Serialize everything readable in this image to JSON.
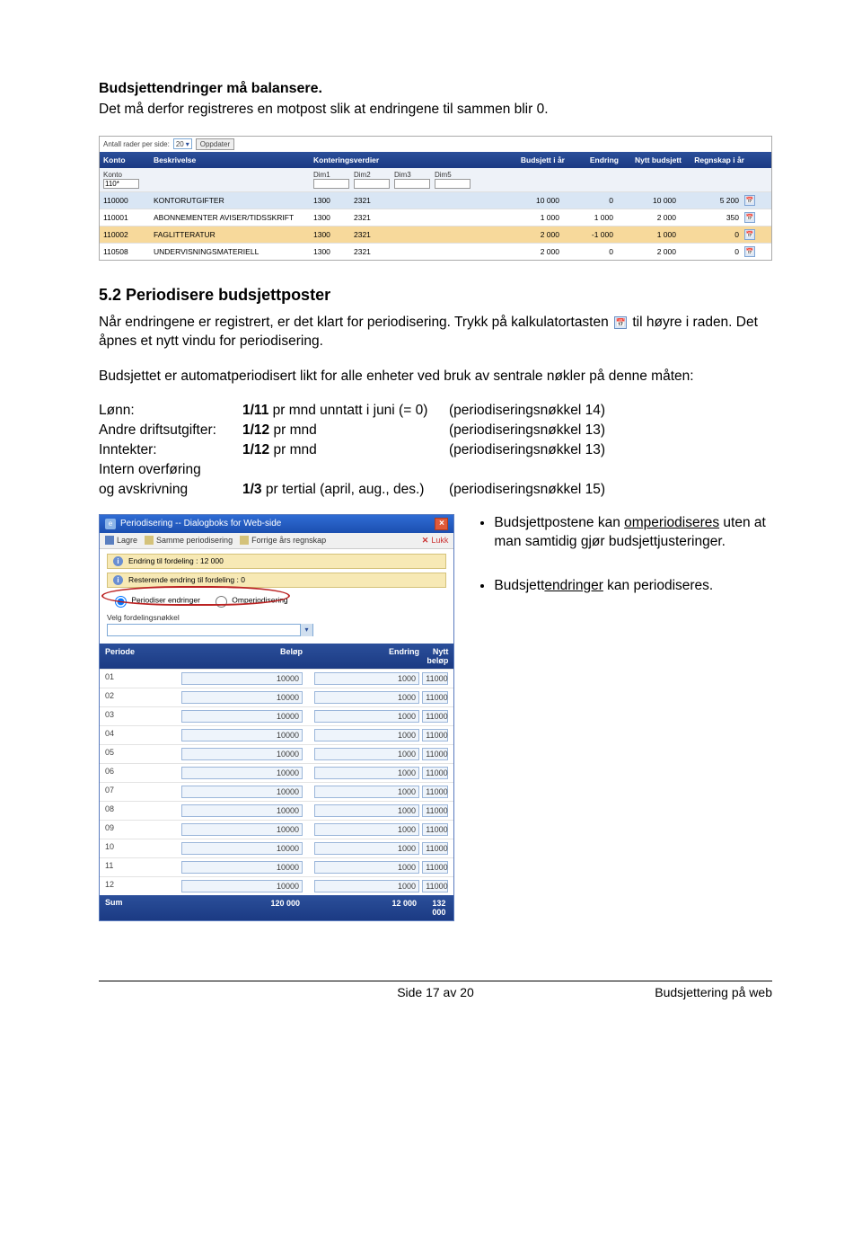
{
  "header": {
    "title": "Budsjettendringer må balansere.",
    "subtitle": "Det må derfor registreres en motpost slik at endringene til sammen blir 0."
  },
  "shot1": {
    "rows_per_side_label": "Antall rader per side:",
    "rows_per_side_value": "20",
    "oppdater_btn": "Oppdater",
    "columns": {
      "konto": "Konto",
      "beskrivelse": "Beskrivelse",
      "konteringsverdier": "Konteringsverdier",
      "budsjett": "Budsjett i år",
      "endring": "Endring",
      "nytt": "Nytt budsjett",
      "regnskap": "Regnskap i år"
    },
    "subcolumns": {
      "konto_label": "Konto",
      "konto_value": "110*",
      "dim1": "Dim1",
      "dim2": "Dim2",
      "dim3": "Dim3",
      "dim5": "Dim5"
    },
    "rows": [
      {
        "konto": "110000",
        "besk": "KONTORUTGIFTER",
        "d1": "1300",
        "d2": "2321",
        "bud": "10 000",
        "end": "0",
        "nytt": "10 000",
        "reg": "5 200"
      },
      {
        "konto": "110001",
        "besk": "ABONNEMENTER AVISER/TIDSSKRIFT",
        "d1": "1300",
        "d2": "2321",
        "bud": "1 000",
        "end": "1 000",
        "nytt": "2 000",
        "reg": "350"
      },
      {
        "konto": "110002",
        "besk": "FAGLITTERATUR",
        "d1": "1300",
        "d2": "2321",
        "bud": "2 000",
        "end": "-1 000",
        "nytt": "1 000",
        "reg": "0"
      },
      {
        "konto": "110508",
        "besk": "UNDERVISNINGSMATERIELL",
        "d1": "1300",
        "d2": "2321",
        "bud": "2 000",
        "end": "0",
        "nytt": "2 000",
        "reg": "0"
      }
    ]
  },
  "section": {
    "num_title": "5.2  Periodisere budsjettposter",
    "p1a": "Når endringene er registrert, er det klart for periodisering. Trykk på kalkulatortasten",
    "p1b": "til høyre i raden. Det åpnes et nytt vindu for periodisering.",
    "p2": "Budsjettet er automatperiodisert likt for alle enheter ved bruk av sentrale nøkler på denne måten:"
  },
  "keys": {
    "lonn_label": "Lønn:",
    "lonn_rate": "1/11",
    "lonn_rate_suffix": " pr mnd unntatt i juni (= 0)",
    "lonn_note": "(periodiseringsnøkkel 14)",
    "drift_label": "Andre driftsutgifter:",
    "drift_rate": "1/12",
    "drift_rate_suffix": " pr mnd",
    "drift_note": "(periodiseringsnøkkel 13)",
    "innt_label": "Inntekter:",
    "innt_rate": "1/12",
    "innt_rate_suffix": " pr mnd",
    "innt_note": "(periodiseringsnøkkel 13)",
    "intern_label1": "Intern overføring",
    "intern_label2": "og avskrivning",
    "intern_rate": "1/3",
    "intern_rate_suffix": " pr tertial (april, aug., des.)",
    "intern_note": "(periodiseringsnøkkel 15)"
  },
  "shot2": {
    "title": "Periodisering -- Dialogboks for Web-side",
    "toolbar": {
      "lagre": "Lagre",
      "samme": "Samme periodisering",
      "forrige": "Forrige års regnskap",
      "lukk": "Lukk"
    },
    "info1": "Endring til fordeling : 12 000",
    "info2": "Resterende endring til fordeling : 0",
    "radio1": "Periodiser endringer",
    "radio2": "Omperiodisering",
    "select_label": "Velg fordelingsnøkkel",
    "cols": {
      "periode": "Periode",
      "belop": "Beløp",
      "endring": "Endring",
      "nytt": "Nytt beløp"
    },
    "rows": [
      {
        "p": "01",
        "b": "10000",
        "e": "1000",
        "n": "11000"
      },
      {
        "p": "02",
        "b": "10000",
        "e": "1000",
        "n": "11000"
      },
      {
        "p": "03",
        "b": "10000",
        "e": "1000",
        "n": "11000"
      },
      {
        "p": "04",
        "b": "10000",
        "e": "1000",
        "n": "11000"
      },
      {
        "p": "05",
        "b": "10000",
        "e": "1000",
        "n": "11000"
      },
      {
        "p": "06",
        "b": "10000",
        "e": "1000",
        "n": "11000"
      },
      {
        "p": "07",
        "b": "10000",
        "e": "1000",
        "n": "11000"
      },
      {
        "p": "08",
        "b": "10000",
        "e": "1000",
        "n": "11000"
      },
      {
        "p": "09",
        "b": "10000",
        "e": "1000",
        "n": "11000"
      },
      {
        "p": "10",
        "b": "10000",
        "e": "1000",
        "n": "11000"
      },
      {
        "p": "11",
        "b": "10000",
        "e": "1000",
        "n": "11000"
      },
      {
        "p": "12",
        "b": "10000",
        "e": "1000",
        "n": "11000"
      }
    ],
    "sum": {
      "label": "Sum",
      "b": "120 000",
      "e": "12 000",
      "n": "132 000"
    }
  },
  "side": {
    "b1a": "Budsjettpostene kan ",
    "b1b_underlined": "omperiodiseres",
    "b1c": " uten at man samtidig gjør budsjettjusteringer.",
    "b2a": "Budsjett",
    "b2b_underlined": "endringer",
    "b2c": " kan periodiseres."
  },
  "footer": {
    "left": "",
    "center": "Side 17 av 20",
    "right": "Budsjettering på web"
  }
}
